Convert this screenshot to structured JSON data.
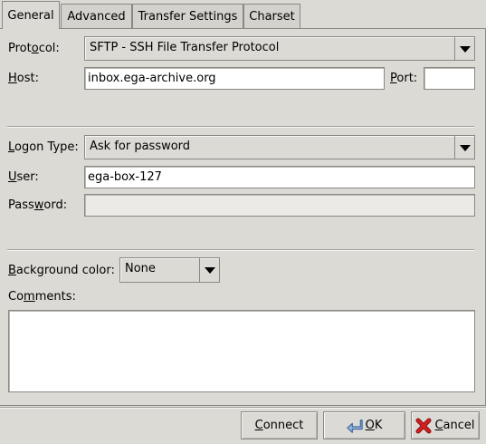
{
  "tabs": [
    {
      "label": "General",
      "active": true
    },
    {
      "label": "Advanced",
      "active": false
    },
    {
      "label": "Transfer Settings",
      "active": false
    },
    {
      "label": "Charset",
      "active": false
    }
  ],
  "protocol": {
    "label_pre": "Prot",
    "label_u": "o",
    "label_post": "col:",
    "value": "SFTP - SSH File Transfer Protocol"
  },
  "host": {
    "label_u": "H",
    "label_post": "ost:",
    "value": "inbox.ega-archive.org"
  },
  "port": {
    "label_u": "P",
    "label_post": "ort:",
    "value": ""
  },
  "logon": {
    "label_u": "L",
    "label_post": "ogon Type:",
    "value": "Ask for password"
  },
  "user": {
    "label_u": "U",
    "label_post": "ser:",
    "value": "ega-box-127"
  },
  "password": {
    "label_pre": "Pass",
    "label_u": "w",
    "label_post": "ord:",
    "value": ""
  },
  "background": {
    "label_u": "B",
    "label_post": "ackground color:",
    "value": "None"
  },
  "comments": {
    "label_pre": "Co",
    "label_u": "m",
    "label_post": "ments:",
    "value": ""
  },
  "buttons": {
    "connect": {
      "label_u": "C",
      "label_post": "onnect"
    },
    "ok": {
      "label_u": "O",
      "label_post": "K",
      "icon": "ok-arrow-icon"
    },
    "cancel": {
      "label_u": "C",
      "label_post": "ancel",
      "icon": "cancel-x-icon"
    }
  },
  "colors": {
    "background": "#dcdad5",
    "border": "#8a8884",
    "cancel_icon": "#d42020",
    "ok_icon": "#3465a4"
  }
}
